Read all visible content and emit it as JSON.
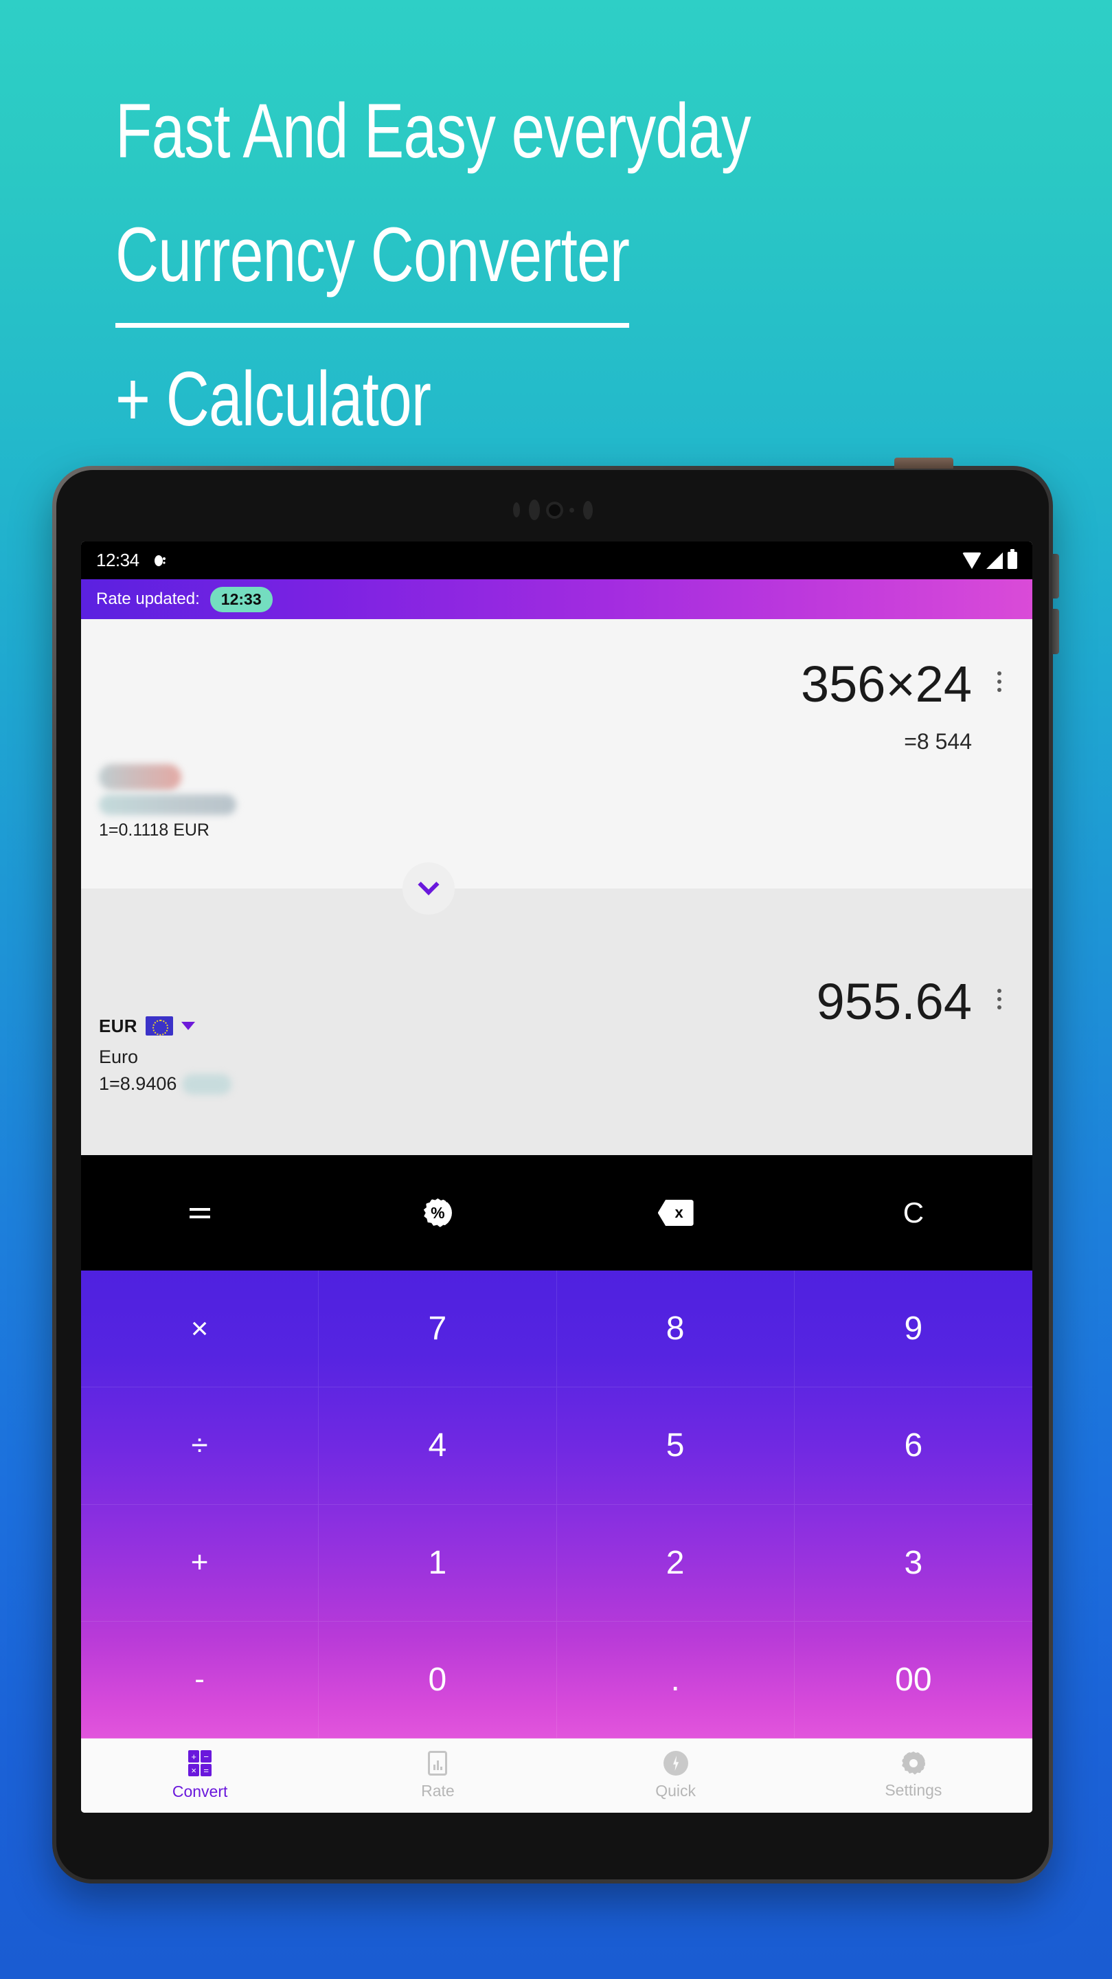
{
  "background": {
    "top_color": "#2ECFC6",
    "bottom_color": "#1A5CD2"
  },
  "headline": {
    "line1": "Fast And Easy everyday",
    "line2": "Currency Converter",
    "line3": "+ Calculator"
  },
  "device": {
    "status_bar": {
      "time": "12:34",
      "notification_icon": "notification-dot-icon",
      "wifi_icon": "wifi-icon",
      "signal_icon": "signal-icon",
      "battery_icon": "battery-icon"
    },
    "power_button": "power-button",
    "volume_up_button": "volume-up-button",
    "volume_down_button": "volume-down-button",
    "front_camera": "front-camera"
  },
  "app": {
    "rate_bar": {
      "label": "Rate updated:",
      "time": "12:33",
      "pill_color": "#74DDC0",
      "gradient_from": "#5B21E0",
      "gradient_to": "#DA4BD8"
    },
    "source": {
      "amount": "356×24",
      "result": "=8 544",
      "code": "",
      "code_redacted": true,
      "name": "",
      "name_redacted": true,
      "rate": "1=0.1118 EUR",
      "rate_redacted": false,
      "menu_icon": "kebab-menu-icon"
    },
    "swap_button": {
      "icon": "chevron-down-icon",
      "color": "#6A18DC"
    },
    "target": {
      "amount": "955.64",
      "code": "EUR",
      "flag_icon": "eu-flag-icon",
      "dropdown_icon": "caret-down-icon",
      "name": "Euro",
      "rate": "1=8.9406",
      "rate_suffix_redacted": true,
      "menu_icon": "kebab-menu-icon"
    },
    "function_bar": [
      {
        "key": "equals",
        "label": "=",
        "icon": "equals-icon"
      },
      {
        "key": "percent",
        "label": "%",
        "icon": "percent-badge-icon"
      },
      {
        "key": "backspace",
        "label": "x",
        "icon": "backspace-icon"
      },
      {
        "key": "clear",
        "label": "C",
        "icon": "clear-icon"
      }
    ],
    "keypad": {
      "gradient_from": "#4F21E0",
      "gradient_to": "#E255DC",
      "rows": [
        [
          "×",
          "7",
          "8",
          "9"
        ],
        [
          "÷",
          "4",
          "5",
          "6"
        ],
        [
          "+",
          "1",
          "2",
          "3"
        ],
        [
          "-",
          "0",
          ".",
          "00"
        ]
      ]
    },
    "bottom_nav": {
      "active_color": "#6A18DC",
      "inactive_color": "#B6B6B6",
      "items": [
        {
          "label": "Convert",
          "icon": "calculator-icon",
          "active": true
        },
        {
          "label": "Rate",
          "icon": "chart-icon",
          "active": false
        },
        {
          "label": "Quick",
          "icon": "flash-icon",
          "active": false
        },
        {
          "label": "Settings",
          "icon": "gear-icon",
          "active": false
        }
      ]
    }
  }
}
